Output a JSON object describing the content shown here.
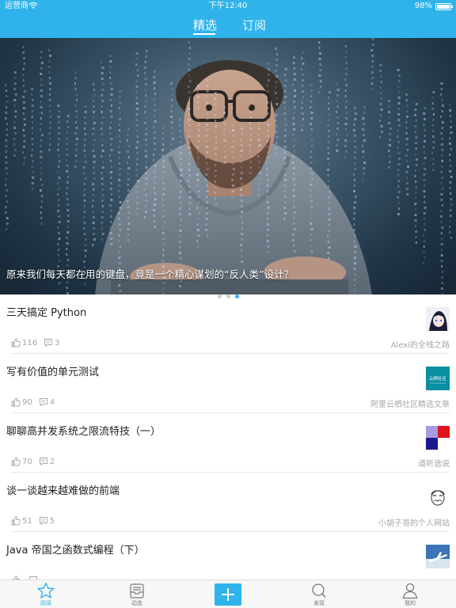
{
  "status_bar": {
    "carrier": "运营商",
    "time": "下午12:40",
    "battery": "98%",
    "battery_level": 0.98
  },
  "header": {
    "tabs": [
      {
        "label": "精选",
        "active": true
      },
      {
        "label": "订阅",
        "active": false
      }
    ]
  },
  "banner": {
    "caption": "原来我们每天都在用的键盘，竟是一个精心谋划的“反人类”设计？",
    "slide_count": 3,
    "active_slide": 3
  },
  "articles": [
    {
      "title": "三天搞定 Python",
      "likes": "116",
      "comments": "3",
      "source": "Alexi的全栈之路",
      "thumb": "anime-avatar"
    },
    {
      "title": "写有价值的单元测试",
      "likes": "90",
      "comments": "4",
      "source": "阿里云栖社区精选文章",
      "thumb": "yunqi-logo",
      "thumb_text": "云栖社区"
    },
    {
      "title": "聊聊高并发系统之限流特技（一）",
      "likes": "70",
      "comments": "2",
      "source": "道听途说",
      "thumb": "color-blocks"
    },
    {
      "title": "谈一谈越来越难做的前端",
      "likes": "51",
      "comments": "5",
      "source": "小胡子哥的个人网站",
      "thumb": "sketch-face"
    },
    {
      "title": "Java 帝国之函数式编程（下）",
      "likes": "",
      "comments": "",
      "source": "",
      "thumb": "airplane-photo"
    }
  ],
  "tabbar": {
    "items": [
      {
        "label": "阅读",
        "icon": "star-icon",
        "active": true
      },
      {
        "label": "动态",
        "icon": "inbox-icon",
        "active": false
      },
      {
        "label": "发现",
        "icon": "search-icon",
        "active": false
      },
      {
        "label": "我的",
        "icon": "user-icon",
        "active": false
      }
    ],
    "add_icon": "plus-icon"
  },
  "colors": {
    "accent": "#2fb3ea",
    "text": "#222222",
    "muted": "#a6a6a6",
    "divider": "#e6e6e6"
  }
}
